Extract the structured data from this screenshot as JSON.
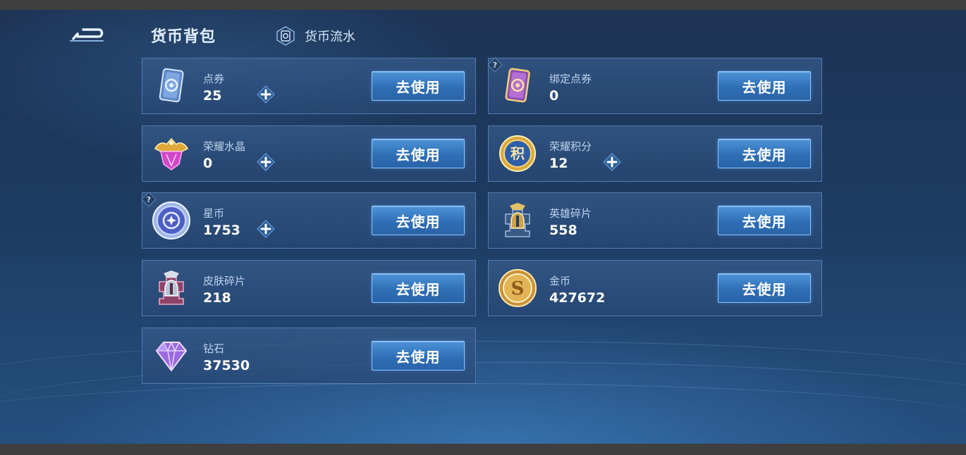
{
  "header": {
    "title": "货币背包",
    "flow_label": "货币流水"
  },
  "colors": {
    "accent": "#3b82cc",
    "button_border": "#8cc6ff",
    "card_border": "#6ea0dc"
  },
  "currencies": [
    {
      "name": "点券",
      "amount": "25",
      "button": "去使用",
      "icon": "coupon-card-icon",
      "has_plus": true,
      "has_help": false
    },
    {
      "name": "绑定点券",
      "amount": "0",
      "button": "去使用",
      "icon": "bound-coupon-card-icon",
      "has_plus": false,
      "has_help": true
    },
    {
      "name": "荣耀水晶",
      "amount": "0",
      "button": "去使用",
      "icon": "glory-crystal-icon",
      "has_plus": true,
      "has_help": false
    },
    {
      "name": "荣耀积分",
      "amount": "12",
      "button": "去使用",
      "icon": "glory-points-icon",
      "has_plus": true,
      "has_help": false
    },
    {
      "name": "星币",
      "amount": "1753",
      "button": "去使用",
      "icon": "star-coin-icon",
      "has_plus": true,
      "has_help": true
    },
    {
      "name": "英雄碎片",
      "amount": "558",
      "button": "去使用",
      "icon": "hero-fragment-icon",
      "has_plus": false,
      "has_help": false
    },
    {
      "name": "皮肤碎片",
      "amount": "218",
      "button": "去使用",
      "icon": "skin-fragment-icon",
      "has_plus": false,
      "has_help": false
    },
    {
      "name": "金币",
      "amount": "427672",
      "button": "去使用",
      "icon": "gold-coin-icon",
      "has_plus": false,
      "has_help": false
    },
    {
      "name": "钻石",
      "amount": "37530",
      "button": "去使用",
      "icon": "diamond-icon",
      "has_plus": false,
      "has_help": false
    }
  ]
}
